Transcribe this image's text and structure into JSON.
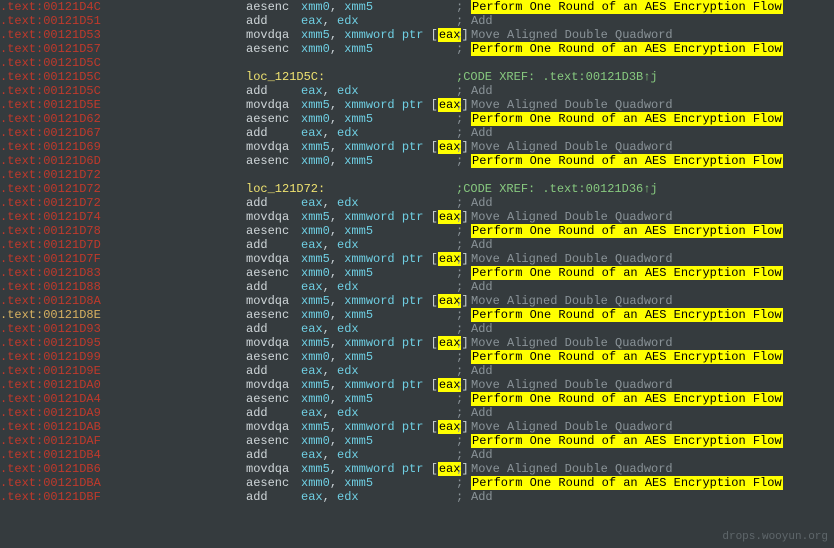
{
  "watermark": "drops.wooyun.org",
  "comments": {
    "aes": "Perform One Round of an AES Encryption Flow",
    "add": "Add",
    "mov": "Move Aligned Double Quadword"
  },
  "xref1_label": "CODE XREF: .text:00121D3B",
  "xref2_label": "CODE XREF: .text:00121D36",
  "arrow_glyph": "↑j",
  "lines": [
    {
      "addr": ".text:00121D4C",
      "sel": false,
      "type": "instr",
      "mn": "aesenc",
      "ops": [
        {
          "t": "reg",
          "v": "xmm0"
        },
        {
          "t": "plain",
          "v": ", "
        },
        {
          "t": "reg",
          "v": "xmm5"
        }
      ],
      "cmt": "aes",
      "hl": true
    },
    {
      "addr": ".text:00121D51",
      "sel": false,
      "type": "instr",
      "mn": "add",
      "ops": [
        {
          "t": "reg",
          "v": "eax"
        },
        {
          "t": "plain",
          "v": ", "
        },
        {
          "t": "reg",
          "v": "edx"
        }
      ],
      "cmt": "add",
      "hl": false
    },
    {
      "addr": ".text:00121D53",
      "sel": false,
      "type": "instr",
      "mn": "movdqa",
      "ops": [
        {
          "t": "reg",
          "v": "xmm5"
        },
        {
          "t": "plain",
          "v": ", "
        },
        {
          "t": "reg",
          "v": "xmmword"
        },
        {
          "t": "plain",
          "v": " "
        },
        {
          "t": "reg",
          "v": "ptr"
        },
        {
          "t": "plain",
          "v": " ["
        },
        {
          "t": "ptr",
          "v": "eax"
        },
        {
          "t": "plain",
          "v": "]"
        }
      ],
      "cmt": "mov",
      "hl": false
    },
    {
      "addr": ".text:00121D57",
      "sel": false,
      "type": "instr",
      "mn": "aesenc",
      "ops": [
        {
          "t": "reg",
          "v": "xmm0"
        },
        {
          "t": "plain",
          "v": ", "
        },
        {
          "t": "reg",
          "v": "xmm5"
        }
      ],
      "cmt": "aes",
      "hl": true
    },
    {
      "addr": ".text:00121D5C",
      "sel": false,
      "type": "blank"
    },
    {
      "addr": ".text:00121D5C",
      "sel": false,
      "type": "loc",
      "loc": "loc_121D5C:",
      "xref": 1
    },
    {
      "addr": ".text:00121D5C",
      "sel": false,
      "type": "instr",
      "mn": "add",
      "ops": [
        {
          "t": "reg",
          "v": "eax"
        },
        {
          "t": "plain",
          "v": ", "
        },
        {
          "t": "reg",
          "v": "edx"
        }
      ],
      "cmt": "add",
      "hl": false
    },
    {
      "addr": ".text:00121D5E",
      "sel": false,
      "type": "instr",
      "mn": "movdqa",
      "ops": [
        {
          "t": "reg",
          "v": "xmm5"
        },
        {
          "t": "plain",
          "v": ", "
        },
        {
          "t": "reg",
          "v": "xmmword"
        },
        {
          "t": "plain",
          "v": " "
        },
        {
          "t": "reg",
          "v": "ptr"
        },
        {
          "t": "plain",
          "v": " ["
        },
        {
          "t": "ptr",
          "v": "eax"
        },
        {
          "t": "plain",
          "v": "]"
        }
      ],
      "cmt": "mov",
      "hl": false
    },
    {
      "addr": ".text:00121D62",
      "sel": false,
      "type": "instr",
      "mn": "aesenc",
      "ops": [
        {
          "t": "reg",
          "v": "xmm0"
        },
        {
          "t": "plain",
          "v": ", "
        },
        {
          "t": "reg",
          "v": "xmm5"
        }
      ],
      "cmt": "aes",
      "hl": true
    },
    {
      "addr": ".text:00121D67",
      "sel": false,
      "type": "instr",
      "mn": "add",
      "ops": [
        {
          "t": "reg",
          "v": "eax"
        },
        {
          "t": "plain",
          "v": ", "
        },
        {
          "t": "reg",
          "v": "edx"
        }
      ],
      "cmt": "add",
      "hl": false
    },
    {
      "addr": ".text:00121D69",
      "sel": false,
      "type": "instr",
      "mn": "movdqa",
      "ops": [
        {
          "t": "reg",
          "v": "xmm5"
        },
        {
          "t": "plain",
          "v": ", "
        },
        {
          "t": "reg",
          "v": "xmmword"
        },
        {
          "t": "plain",
          "v": " "
        },
        {
          "t": "reg",
          "v": "ptr"
        },
        {
          "t": "plain",
          "v": " ["
        },
        {
          "t": "ptr",
          "v": "eax"
        },
        {
          "t": "plain",
          "v": "]"
        }
      ],
      "cmt": "mov",
      "hl": false
    },
    {
      "addr": ".text:00121D6D",
      "sel": false,
      "type": "instr",
      "mn": "aesenc",
      "ops": [
        {
          "t": "reg",
          "v": "xmm0"
        },
        {
          "t": "plain",
          "v": ", "
        },
        {
          "t": "reg",
          "v": "xmm5"
        }
      ],
      "cmt": "aes",
      "hl": true
    },
    {
      "addr": ".text:00121D72",
      "sel": false,
      "type": "blank"
    },
    {
      "addr": ".text:00121D72",
      "sel": false,
      "type": "loc",
      "loc": "loc_121D72:",
      "xref": 2
    },
    {
      "addr": ".text:00121D72",
      "sel": false,
      "type": "instr",
      "mn": "add",
      "ops": [
        {
          "t": "reg",
          "v": "eax"
        },
        {
          "t": "plain",
          "v": ", "
        },
        {
          "t": "reg",
          "v": "edx"
        }
      ],
      "cmt": "add",
      "hl": false
    },
    {
      "addr": ".text:00121D74",
      "sel": false,
      "type": "instr",
      "mn": "movdqa",
      "ops": [
        {
          "t": "reg",
          "v": "xmm5"
        },
        {
          "t": "plain",
          "v": ", "
        },
        {
          "t": "reg",
          "v": "xmmword"
        },
        {
          "t": "plain",
          "v": " "
        },
        {
          "t": "reg",
          "v": "ptr"
        },
        {
          "t": "plain",
          "v": " ["
        },
        {
          "t": "ptr",
          "v": "eax"
        },
        {
          "t": "plain",
          "v": "]"
        }
      ],
      "cmt": "mov",
      "hl": false
    },
    {
      "addr": ".text:00121D78",
      "sel": false,
      "type": "instr",
      "mn": "aesenc",
      "ops": [
        {
          "t": "reg",
          "v": "xmm0"
        },
        {
          "t": "plain",
          "v": ", "
        },
        {
          "t": "reg",
          "v": "xmm5"
        }
      ],
      "cmt": "aes",
      "hl": true
    },
    {
      "addr": ".text:00121D7D",
      "sel": false,
      "type": "instr",
      "mn": "add",
      "ops": [
        {
          "t": "reg",
          "v": "eax"
        },
        {
          "t": "plain",
          "v": ", "
        },
        {
          "t": "reg",
          "v": "edx"
        }
      ],
      "cmt": "add",
      "hl": false
    },
    {
      "addr": ".text:00121D7F",
      "sel": false,
      "type": "instr",
      "mn": "movdqa",
      "ops": [
        {
          "t": "reg",
          "v": "xmm5"
        },
        {
          "t": "plain",
          "v": ", "
        },
        {
          "t": "reg",
          "v": "xmmword"
        },
        {
          "t": "plain",
          "v": " "
        },
        {
          "t": "reg",
          "v": "ptr"
        },
        {
          "t": "plain",
          "v": " ["
        },
        {
          "t": "ptr",
          "v": "eax"
        },
        {
          "t": "plain",
          "v": "]"
        }
      ],
      "cmt": "mov",
      "hl": false
    },
    {
      "addr": ".text:00121D83",
      "sel": false,
      "type": "instr",
      "mn": "aesenc",
      "ops": [
        {
          "t": "reg",
          "v": "xmm0"
        },
        {
          "t": "plain",
          "v": ", "
        },
        {
          "t": "reg",
          "v": "xmm5"
        }
      ],
      "cmt": "aes",
      "hl": true
    },
    {
      "addr": ".text:00121D88",
      "sel": false,
      "type": "instr",
      "mn": "add",
      "ops": [
        {
          "t": "reg",
          "v": "eax"
        },
        {
          "t": "plain",
          "v": ", "
        },
        {
          "t": "reg",
          "v": "edx"
        }
      ],
      "cmt": "add",
      "hl": false
    },
    {
      "addr": ".text:00121D8A",
      "sel": false,
      "type": "instr",
      "mn": "movdqa",
      "ops": [
        {
          "t": "reg",
          "v": "xmm5"
        },
        {
          "t": "plain",
          "v": ", "
        },
        {
          "t": "reg",
          "v": "xmmword"
        },
        {
          "t": "plain",
          "v": " "
        },
        {
          "t": "reg",
          "v": "ptr"
        },
        {
          "t": "plain",
          "v": " ["
        },
        {
          "t": "ptr",
          "v": "eax"
        },
        {
          "t": "plain",
          "v": "]"
        }
      ],
      "cmt": "mov",
      "hl": false
    },
    {
      "addr": ".text:00121D8E",
      "sel": true,
      "type": "instr",
      "mn": "aesenc",
      "ops": [
        {
          "t": "reg",
          "v": "xmm0"
        },
        {
          "t": "plain",
          "v": ", "
        },
        {
          "t": "reg",
          "v": "xmm5"
        }
      ],
      "cmt": "aes",
      "hl": true
    },
    {
      "addr": ".text:00121D93",
      "sel": false,
      "type": "instr",
      "mn": "add",
      "ops": [
        {
          "t": "reg",
          "v": "eax"
        },
        {
          "t": "plain",
          "v": ", "
        },
        {
          "t": "reg",
          "v": "edx"
        }
      ],
      "cmt": "add",
      "hl": false
    },
    {
      "addr": ".text:00121D95",
      "sel": false,
      "type": "instr",
      "mn": "movdqa",
      "ops": [
        {
          "t": "reg",
          "v": "xmm5"
        },
        {
          "t": "plain",
          "v": ", "
        },
        {
          "t": "reg",
          "v": "xmmword"
        },
        {
          "t": "plain",
          "v": " "
        },
        {
          "t": "reg",
          "v": "ptr"
        },
        {
          "t": "plain",
          "v": " ["
        },
        {
          "t": "ptr",
          "v": "eax"
        },
        {
          "t": "plain",
          "v": "]"
        }
      ],
      "cmt": "mov",
      "hl": false
    },
    {
      "addr": ".text:00121D99",
      "sel": false,
      "type": "instr",
      "mn": "aesenc",
      "ops": [
        {
          "t": "reg",
          "v": "xmm0"
        },
        {
          "t": "plain",
          "v": ", "
        },
        {
          "t": "reg",
          "v": "xmm5"
        }
      ],
      "cmt": "aes",
      "hl": true
    },
    {
      "addr": ".text:00121D9E",
      "sel": false,
      "type": "instr",
      "mn": "add",
      "ops": [
        {
          "t": "reg",
          "v": "eax"
        },
        {
          "t": "plain",
          "v": ", "
        },
        {
          "t": "reg",
          "v": "edx"
        }
      ],
      "cmt": "add",
      "hl": false
    },
    {
      "addr": ".text:00121DA0",
      "sel": false,
      "type": "instr",
      "mn": "movdqa",
      "ops": [
        {
          "t": "reg",
          "v": "xmm5"
        },
        {
          "t": "plain",
          "v": ", "
        },
        {
          "t": "reg",
          "v": "xmmword"
        },
        {
          "t": "plain",
          "v": " "
        },
        {
          "t": "reg",
          "v": "ptr"
        },
        {
          "t": "plain",
          "v": " ["
        },
        {
          "t": "ptr",
          "v": "eax"
        },
        {
          "t": "plain",
          "v": "]"
        }
      ],
      "cmt": "mov",
      "hl": false
    },
    {
      "addr": ".text:00121DA4",
      "sel": false,
      "type": "instr",
      "mn": "aesenc",
      "ops": [
        {
          "t": "reg",
          "v": "xmm0"
        },
        {
          "t": "plain",
          "v": ", "
        },
        {
          "t": "reg",
          "v": "xmm5"
        }
      ],
      "cmt": "aes",
      "hl": true
    },
    {
      "addr": ".text:00121DA9",
      "sel": false,
      "type": "instr",
      "mn": "add",
      "ops": [
        {
          "t": "reg",
          "v": "eax"
        },
        {
          "t": "plain",
          "v": ", "
        },
        {
          "t": "reg",
          "v": "edx"
        }
      ],
      "cmt": "add",
      "hl": false
    },
    {
      "addr": ".text:00121DAB",
      "sel": false,
      "type": "instr",
      "mn": "movdqa",
      "ops": [
        {
          "t": "reg",
          "v": "xmm5"
        },
        {
          "t": "plain",
          "v": ", "
        },
        {
          "t": "reg",
          "v": "xmmword"
        },
        {
          "t": "plain",
          "v": " "
        },
        {
          "t": "reg",
          "v": "ptr"
        },
        {
          "t": "plain",
          "v": " ["
        },
        {
          "t": "ptr",
          "v": "eax"
        },
        {
          "t": "plain",
          "v": "]"
        }
      ],
      "cmt": "mov",
      "hl": false
    },
    {
      "addr": ".text:00121DAF",
      "sel": false,
      "type": "instr",
      "mn": "aesenc",
      "ops": [
        {
          "t": "reg",
          "v": "xmm0"
        },
        {
          "t": "plain",
          "v": ", "
        },
        {
          "t": "reg",
          "v": "xmm5"
        }
      ],
      "cmt": "aes",
      "hl": true
    },
    {
      "addr": ".text:00121DB4",
      "sel": false,
      "type": "instr",
      "mn": "add",
      "ops": [
        {
          "t": "reg",
          "v": "eax"
        },
        {
          "t": "plain",
          "v": ", "
        },
        {
          "t": "reg",
          "v": "edx"
        }
      ],
      "cmt": "add",
      "hl": false
    },
    {
      "addr": ".text:00121DB6",
      "sel": false,
      "type": "instr",
      "mn": "movdqa",
      "ops": [
        {
          "t": "reg",
          "v": "xmm5"
        },
        {
          "t": "plain",
          "v": ", "
        },
        {
          "t": "reg",
          "v": "xmmword"
        },
        {
          "t": "plain",
          "v": " "
        },
        {
          "t": "reg",
          "v": "ptr"
        },
        {
          "t": "plain",
          "v": " ["
        },
        {
          "t": "ptr",
          "v": "eax"
        },
        {
          "t": "plain",
          "v": "]"
        }
      ],
      "cmt": "mov",
      "hl": false
    },
    {
      "addr": ".text:00121DBA",
      "sel": false,
      "type": "instr",
      "mn": "aesenc",
      "ops": [
        {
          "t": "reg",
          "v": "xmm0"
        },
        {
          "t": "plain",
          "v": ", "
        },
        {
          "t": "reg",
          "v": "xmm5"
        }
      ],
      "cmt": "aes",
      "hl": true
    },
    {
      "addr": ".text:00121DBF",
      "sel": false,
      "type": "instr",
      "mn": "add",
      "ops": [
        {
          "t": "reg",
          "v": "eax"
        },
        {
          "t": "plain",
          "v": ", "
        },
        {
          "t": "reg",
          "v": "edx"
        }
      ],
      "cmt": "add",
      "hl": false
    }
  ]
}
